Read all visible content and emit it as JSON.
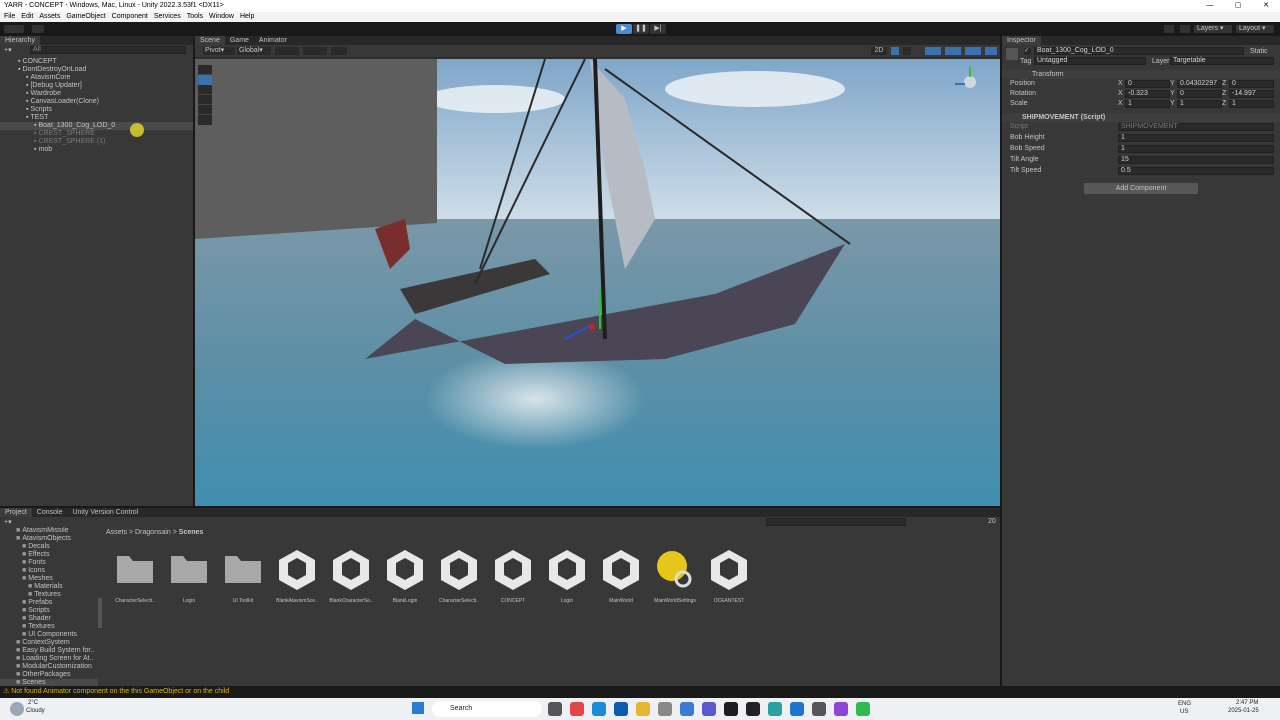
{
  "window": {
    "title": "YARR - CONCEPT - Windows, Mac, Linux - Unity 2022.3.53f1 <DX11>",
    "menu": [
      "File",
      "Edit",
      "Assets",
      "GameObject",
      "Component",
      "Services",
      "Tools",
      "Window",
      "Help"
    ]
  },
  "toolbar": {
    "layers": "Layers",
    "layout": "Layout"
  },
  "hierarchy": {
    "tab": "Hierarchy",
    "search_placeholder": "All",
    "items": [
      {
        "label": "CONCEPT",
        "depth": 0
      },
      {
        "label": "DontDestroyOnLoad",
        "depth": 0
      },
      {
        "label": "AtavismCore",
        "depth": 1
      },
      {
        "label": "[Debug Updater]",
        "depth": 1
      },
      {
        "label": "Wardrobe",
        "depth": 1
      },
      {
        "label": "CanvasLoader(Clone)",
        "depth": 1
      },
      {
        "label": "Scripts",
        "depth": 1
      },
      {
        "label": "TEST",
        "depth": 1
      },
      {
        "label": "Boat_1300_Cog_LOD_0",
        "depth": 2
      },
      {
        "label": "CREST_SPHERE",
        "depth": 2
      },
      {
        "label": "CREST_SPHERE (1)",
        "depth": 2
      },
      {
        "label": "mob",
        "depth": 2
      }
    ]
  },
  "scene": {
    "tabs": [
      "Scene",
      "Game",
      "Animator"
    ],
    "pivot": "Pivot",
    "global": "Global",
    "mode_2d": "2D"
  },
  "inspector": {
    "tab": "Inspector",
    "object_name": "Boat_1300_Cog_LOD_0",
    "static_label": "Static",
    "tag_label": "Tag",
    "tag_value": "Untagged",
    "layer_label": "Layer",
    "layer_value": "Targetable",
    "transform": {
      "title": "Transform",
      "position": {
        "label": "Position",
        "x": "0",
        "y": "0.04302297",
        "z": "0"
      },
      "rotation": {
        "label": "Rotation",
        "x": "-0.323",
        "y": "0",
        "z": "-14.997"
      },
      "scale": {
        "label": "Scale",
        "x": "1",
        "y": "1",
        "z": "1"
      }
    },
    "script_component": {
      "title": "SHIPMOVEMENT (Script)",
      "script_label": "Script",
      "script_value": "SHIPMOVEMENT",
      "fields": [
        {
          "label": "Bob Height",
          "value": "1"
        },
        {
          "label": "Bob Speed",
          "value": "1"
        },
        {
          "label": "Tilt Angle",
          "value": "15"
        },
        {
          "label": "Tilt Speed",
          "value": "0.5"
        }
      ]
    },
    "add_component": "Add Component"
  },
  "project": {
    "tabs": [
      "Project",
      "Console",
      "Unity Version Control"
    ],
    "tree": [
      "AtavismMissile",
      "AtavismObjects",
      "Decals",
      "Effects",
      "Fonts",
      "Icons",
      "Meshes",
      "Materials",
      "Textures",
      "Prefabs",
      "Scripts",
      "Shader",
      "Textures",
      "UI Components",
      "ContextSystem",
      "Easy Build System for..",
      "Loading Screen for At..",
      "ModularCustomization",
      "OtherPackages",
      "Scenes"
    ],
    "breadcrumb": [
      "Assets",
      "Dragonsain",
      "Scenes"
    ],
    "count": "20",
    "assets": [
      {
        "label": "CharacterSelecti..",
        "icon": "folder"
      },
      {
        "label": "Login",
        "icon": "folder"
      },
      {
        "label": "UI Toolkit",
        "icon": "folder"
      },
      {
        "label": "BlankAtavismSce..",
        "icon": "unity-scene"
      },
      {
        "label": "BlankCharacterSe..",
        "icon": "unity-scene"
      },
      {
        "label": "BlankLogin",
        "icon": "unity-scene"
      },
      {
        "label": "CharacterSelecti..",
        "icon": "unity-scene"
      },
      {
        "label": "CONCEPT",
        "icon": "unity-scene"
      },
      {
        "label": "Login",
        "icon": "unity-scene"
      },
      {
        "label": "MainWorld",
        "icon": "unity-scene"
      },
      {
        "label": "MainWorldSettings",
        "icon": "lighting-settings"
      },
      {
        "label": "OCEANTEST",
        "icon": "unity-scene"
      }
    ]
  },
  "status": {
    "message": "Not found Animator component on the this GameObject or on the child"
  },
  "taskbar": {
    "weather_temp": "2°C",
    "weather_desc": "Cloudy",
    "search": "Search",
    "lang1": "ENG",
    "lang2": "US",
    "time": "2:47 PM",
    "date": "2025-01-25"
  },
  "colors": {
    "accent": "#3a72b0",
    "play_active": "#4d8bd2",
    "status_warn": "#e0b800"
  }
}
